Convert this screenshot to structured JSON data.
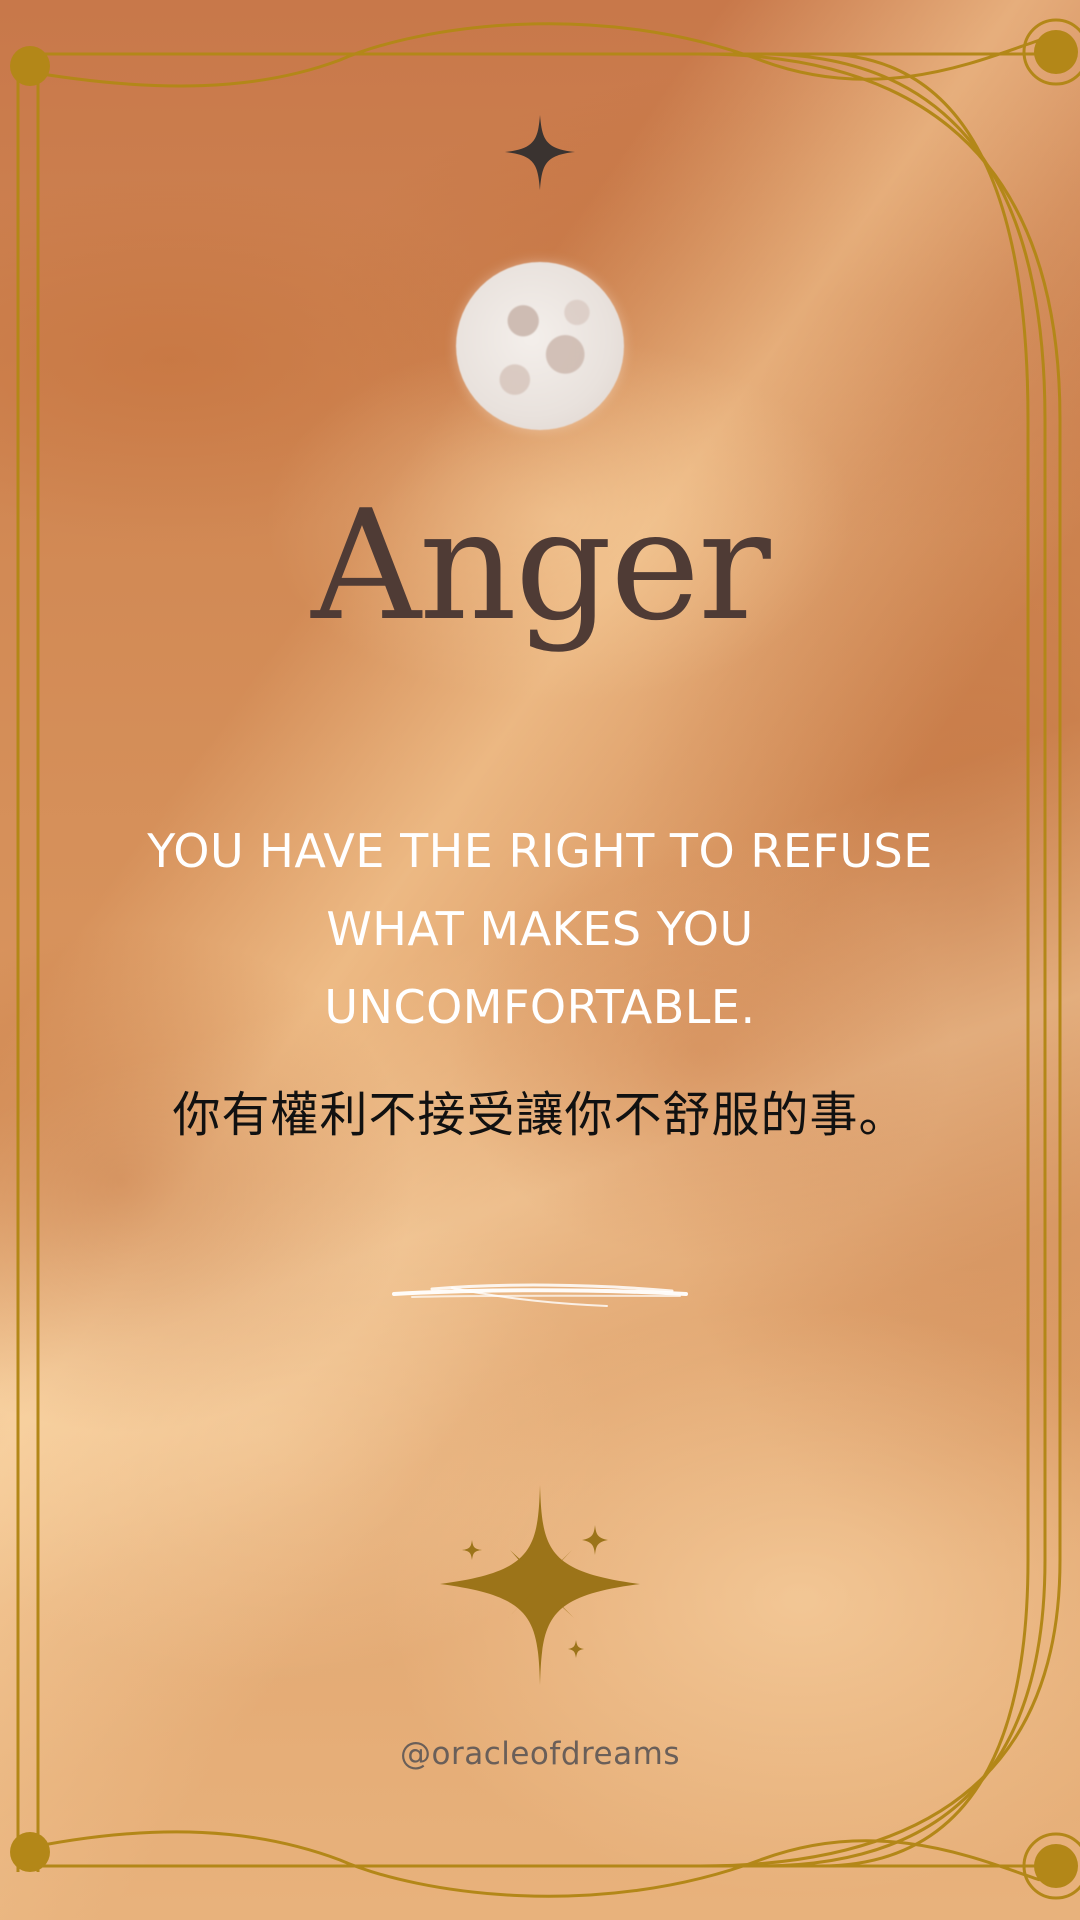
{
  "card": {
    "title": "Anger",
    "quote_en_lines": [
      "YOU HAVE THE RIGHT TO REFUSE",
      "WHAT MAKES YOU",
      "UNCOMFORTABLE."
    ],
    "quote_zh": "你有權利不接受讓你不舒服的事。",
    "handle": "@oracleofdreams"
  },
  "colors": {
    "frame_gold": "#b38718",
    "title": "#4f3b35",
    "quote_en": "#ffffff",
    "quote_zh": "#111111",
    "handle": "#6a5f59",
    "top_star": "#3a3330",
    "bottom_sparkle": "#9c7419"
  },
  "icons": {
    "top": "four-point-star-icon",
    "moon": "full-moon-image",
    "divider": "brush-stroke-divider",
    "bottom": "sparkle-stars-icon"
  }
}
